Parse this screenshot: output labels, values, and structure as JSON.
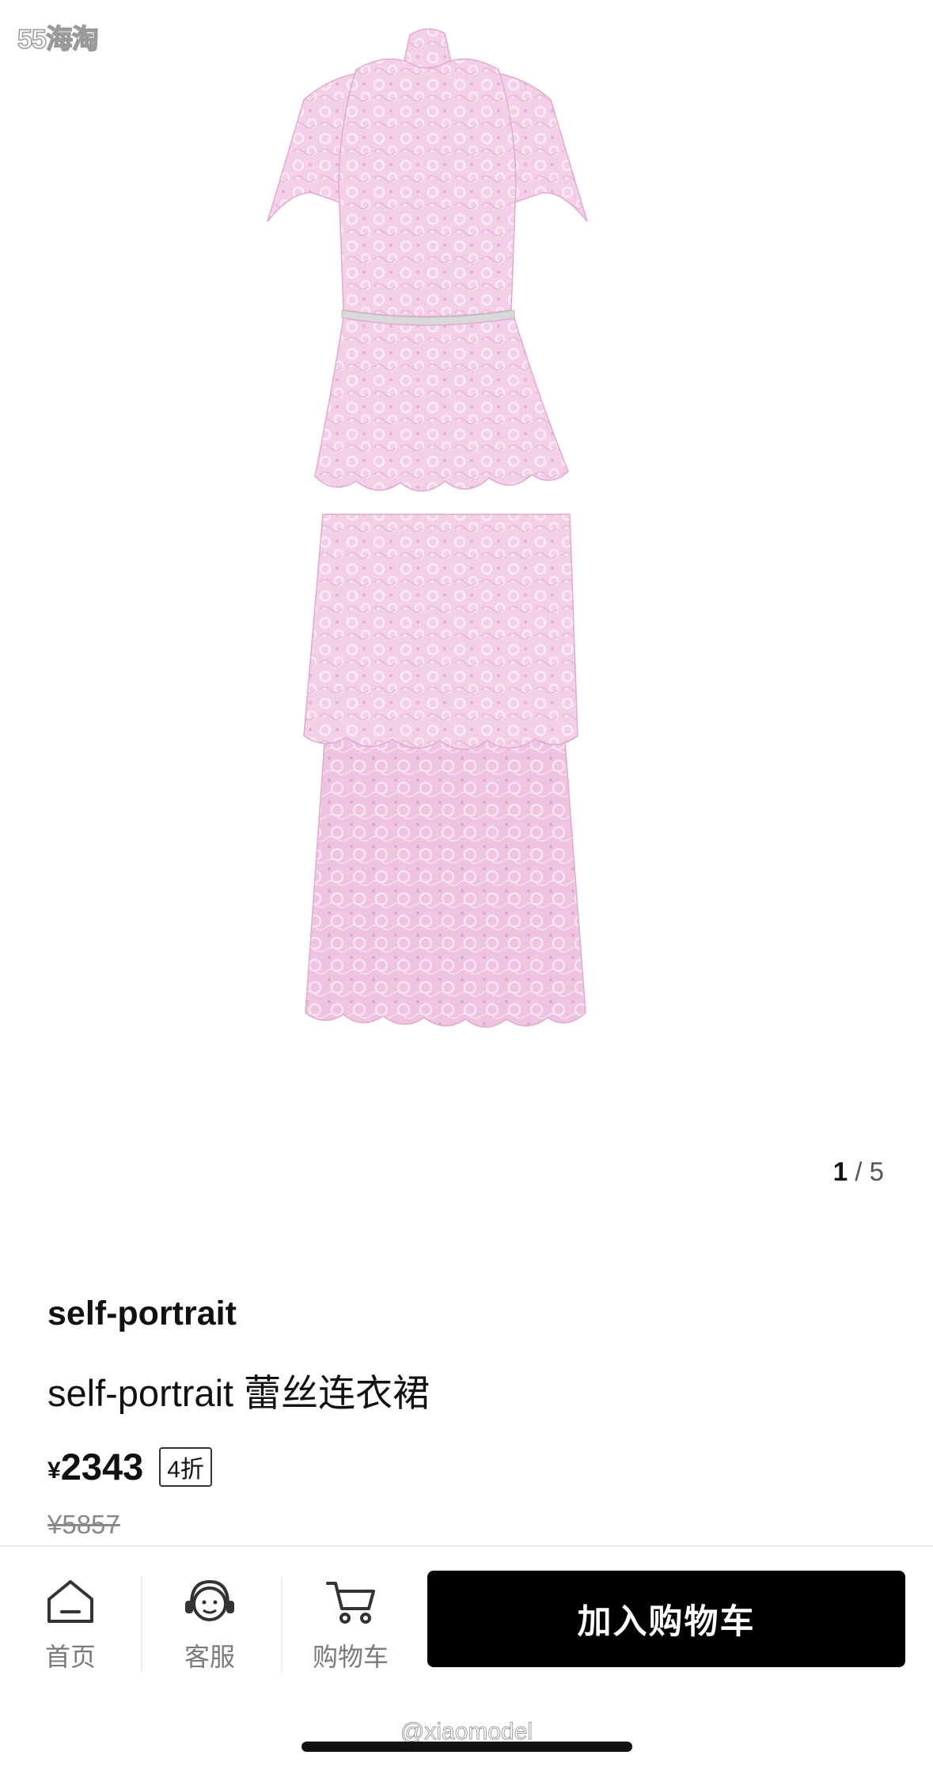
{
  "watermark_top": "55海淘",
  "gallery": {
    "current": "1",
    "separator": " / ",
    "total": "5"
  },
  "product": {
    "brand": "self-portrait",
    "title": "self-portrait 蕾丝连衣裙",
    "currency": "¥",
    "price": "2343",
    "discount": "4折",
    "original_price": "¥5857",
    "image_color": "#f1c9e4"
  },
  "bottom_bar": {
    "home_label": "首页",
    "service_label": "客服",
    "cart_label": "购物车",
    "add_to_cart_label": "加入购物车",
    "home_icon": "home-icon",
    "service_icon": "customer-service-icon",
    "cart_icon": "shopping-cart-icon"
  },
  "watermark_bottom": "@xiaomodel"
}
